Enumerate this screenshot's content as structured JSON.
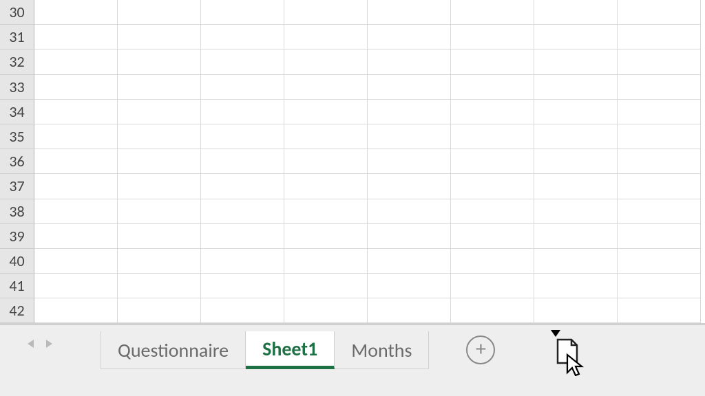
{
  "rows": [
    30,
    31,
    32,
    33,
    34,
    35,
    36,
    37,
    38,
    39,
    40,
    41,
    42
  ],
  "columns_visible": 8,
  "tabs": {
    "items": [
      {
        "label": "Questionnaire",
        "active": false
      },
      {
        "label": "Sheet1",
        "active": true
      },
      {
        "label": "Months",
        "active": false
      }
    ],
    "new_sheet_glyph": "+"
  },
  "colors": {
    "accent": "#1e7145",
    "tab_text": "#6a6a6a",
    "grid_line": "#d9d9d9"
  },
  "icons": {
    "nav_left": "triangle-left",
    "nav_right": "triangle-right",
    "new_sheet": "plus-circle",
    "drag_cursor": "sheet-page-with-pointer",
    "insert_marker": "triangle-down"
  }
}
